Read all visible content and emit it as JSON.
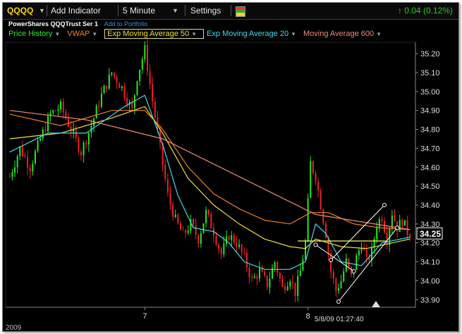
{
  "toolbar": {
    "symbol": "QQQQ",
    "add_indicator": "Add Indicator",
    "interval": "5 Minute",
    "settings": "Settings",
    "change": "↑ 0.04 (0.12%)",
    "colors": {
      "symbol": "#ffd500",
      "change": "#1fd61f"
    }
  },
  "subtitle": {
    "name": "PowerShares QQQTrust Ser 1",
    "add_to_portfolio": "Add to Portfolio"
  },
  "legend": [
    {
      "label": "Price History",
      "color": "#2ee82e",
      "boxed": false
    },
    {
      "label": "VWAP",
      "color": "#f08020",
      "boxed": false
    },
    {
      "label": "Exp Moving Average 50",
      "color": "#f0e030",
      "boxed": true
    },
    {
      "label": "Exp Moving Average 20",
      "color": "#40d8f0",
      "boxed": false
    },
    {
      "label": "Moving Average 600",
      "color": "#f08878",
      "boxed": false
    }
  ],
  "chart_data": {
    "type": "candlestick",
    "ylim": [
      33.86,
      35.26
    ],
    "y_ticks": [
      "35.20",
      "35.10",
      "35.00",
      "34.90",
      "34.80",
      "34.70",
      "34.60",
      "34.50",
      "34.40",
      "34.30",
      "34.20",
      "34.10",
      "34.00",
      "33.90"
    ],
    "x_ticks": [
      {
        "label": "7",
        "bar_index": 53
      },
      {
        "label": "8",
        "bar_index": 117
      }
    ],
    "x_left_label": "2009",
    "timestamp": "5/8/09 01:27:40",
    "last_price": "34.25",
    "bar_count": 158,
    "candle_colors": {
      "up": "#22ee22",
      "down": "#ee2222"
    },
    "price_path": [
      [
        0,
        34.55
      ],
      [
        4,
        34.7
      ],
      [
        8,
        34.6
      ],
      [
        12,
        34.75
      ],
      [
        16,
        34.88
      ],
      [
        20,
        34.92
      ],
      [
        24,
        34.8
      ],
      [
        28,
        34.68
      ],
      [
        32,
        34.82
      ],
      [
        36,
        34.98
      ],
      [
        40,
        35.1
      ],
      [
        44,
        35.02
      ],
      [
        48,
        34.9
      ],
      [
        50,
        35.08
      ],
      [
        53,
        35.22
      ],
      [
        56,
        34.95
      ],
      [
        59,
        34.7
      ],
      [
        62,
        34.45
      ],
      [
        65,
        34.32
      ],
      [
        68,
        34.24
      ],
      [
        71,
        34.3
      ],
      [
        74,
        34.22
      ],
      [
        77,
        34.36
      ],
      [
        80,
        34.26
      ],
      [
        83,
        34.14
      ],
      [
        86,
        34.24
      ],
      [
        89,
        34.2
      ],
      [
        92,
        34.12
      ],
      [
        95,
        34.0
      ],
      [
        98,
        34.05
      ],
      [
        101,
        33.98
      ],
      [
        104,
        34.1
      ],
      [
        107,
        33.96
      ],
      [
        110,
        34.02
      ],
      [
        112,
        33.94
      ],
      [
        114,
        34.05
      ],
      [
        116,
        34.2
      ],
      [
        118,
        34.62
      ],
      [
        120,
        34.55
      ],
      [
        122,
        34.4
      ],
      [
        124,
        34.25
      ],
      [
        126,
        34.05
      ],
      [
        128,
        33.95
      ],
      [
        130,
        34.0
      ],
      [
        132,
        34.1
      ],
      [
        134,
        34.02
      ],
      [
        136,
        34.12
      ],
      [
        138,
        34.2
      ],
      [
        140,
        34.1
      ],
      [
        142,
        34.15
      ],
      [
        144,
        34.3
      ],
      [
        146,
        34.34
      ],
      [
        148,
        34.22
      ],
      [
        150,
        34.36
      ],
      [
        152,
        34.28
      ],
      [
        154,
        34.32
      ],
      [
        156,
        34.26
      ],
      [
        157,
        34.25
      ]
    ],
    "series": [
      {
        "name": "VWAP",
        "color": "#f08020",
        "values": [
          [
            0,
            34.88
          ],
          [
            20,
            34.82
          ],
          [
            40,
            34.9
          ],
          [
            53,
            34.9
          ],
          [
            60,
            34.8
          ],
          [
            70,
            34.6
          ],
          [
            80,
            34.46
          ],
          [
            90,
            34.38
          ],
          [
            100,
            34.32
          ],
          [
            110,
            34.3
          ],
          [
            118,
            34.36
          ],
          [
            125,
            34.36
          ],
          [
            135,
            34.3
          ],
          [
            145,
            34.28
          ],
          [
            157,
            34.27
          ]
        ]
      },
      {
        "name": "Exp Moving Average 50",
        "color": "#f0e030",
        "values": [
          [
            0,
            34.75
          ],
          [
            20,
            34.78
          ],
          [
            40,
            34.86
          ],
          [
            53,
            34.92
          ],
          [
            60,
            34.78
          ],
          [
            70,
            34.54
          ],
          [
            80,
            34.4
          ],
          [
            90,
            34.3
          ],
          [
            100,
            34.22
          ],
          [
            110,
            34.18
          ],
          [
            116,
            34.17
          ],
          [
            120,
            34.22
          ],
          [
            130,
            34.18
          ],
          [
            140,
            34.17
          ],
          [
            150,
            34.2
          ],
          [
            157,
            34.22
          ]
        ]
      },
      {
        "name": "Exp Moving Average 20",
        "color": "#40d8f0",
        "values": [
          [
            0,
            34.68
          ],
          [
            15,
            34.78
          ],
          [
            30,
            34.78
          ],
          [
            45,
            34.92
          ],
          [
            53,
            34.98
          ],
          [
            60,
            34.72
          ],
          [
            66,
            34.45
          ],
          [
            72,
            34.28
          ],
          [
            80,
            34.26
          ],
          [
            86,
            34.2
          ],
          [
            92,
            34.1
          ],
          [
            100,
            34.06
          ],
          [
            110,
            34.06
          ],
          [
            116,
            34.1
          ],
          [
            120,
            34.3
          ],
          [
            124,
            34.25
          ],
          [
            130,
            34.1
          ],
          [
            138,
            34.08
          ],
          [
            146,
            34.2
          ],
          [
            157,
            34.23
          ]
        ]
      },
      {
        "name": "Moving Average 600",
        "color": "#f08878",
        "values": [
          [
            0,
            34.9
          ],
          [
            30,
            34.85
          ],
          [
            60,
            34.75
          ],
          [
            90,
            34.55
          ],
          [
            120,
            34.35
          ],
          [
            157,
            34.27
          ]
        ]
      }
    ],
    "annotations": {
      "support_line": {
        "y": 34.21,
        "x_start": 113,
        "x_end": 148,
        "color": "#ffff60"
      },
      "channel_lines": [
        {
          "p1": [
            126,
            34.11
          ],
          "p2": [
            147,
            34.4
          ],
          "color": "#ffffff"
        },
        {
          "p1": [
            129,
            33.89
          ],
          "p2": [
            152,
            34.28
          ],
          "color": "#ffffff"
        }
      ],
      "small_lines": [
        {
          "p1": [
            120,
            34.19
          ],
          "p2": [
            135,
            34.05
          ],
          "color": "#ffffff"
        }
      ]
    }
  }
}
